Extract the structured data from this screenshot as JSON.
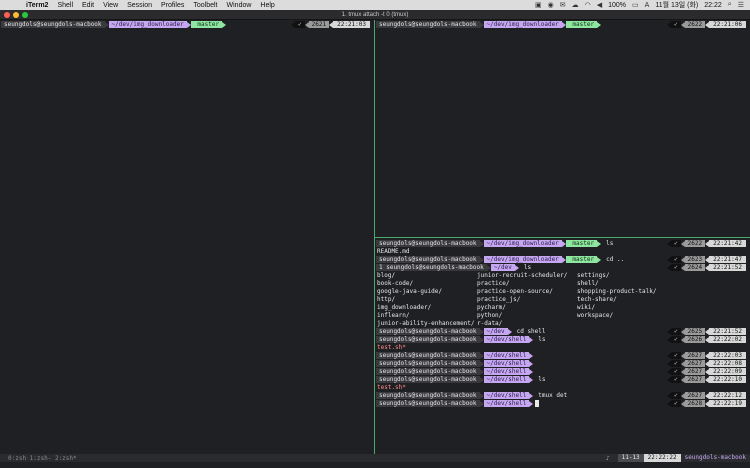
{
  "menubar": {
    "apple": "",
    "items": [
      "iTerm2",
      "Shell",
      "Edit",
      "View",
      "Session",
      "Profiles",
      "Toolbelt",
      "Window",
      "Help"
    ],
    "battery": "100%",
    "date": "11월 13일 (화)",
    "clock": "22:22"
  },
  "window": {
    "title": "1. tmux attach -t 0 (tmux)"
  },
  "panes": {
    "left": {
      "prompt": {
        "user": "seungdols@seungdols-macbook",
        "dir": "~/dev/img_downloader",
        "git": " master"
      },
      "right": {
        "check": "✓",
        "num": "2621",
        "time": "22:21:03"
      }
    },
    "top_right": {
      "prompt": {
        "user": "seungdols@seungdols-macbook",
        "dir": "~/dev/img_downloader",
        "git": " master"
      },
      "right": {
        "check": "✓",
        "num": "2622",
        "time": "22:21:06"
      }
    },
    "bottom_right": {
      "lines": [
        {
          "type": "prompt",
          "user": "seungdols@seungdols-macbook",
          "dir": "~/dev/img_downloader",
          "git": " master",
          "cmd": "ls",
          "check": "✓",
          "num": "2622",
          "time": "22:21:42"
        },
        {
          "type": "out",
          "text": "README.md"
        },
        {
          "type": "prompt",
          "user": "seungdols@seungdols-macbook",
          "dir": "~/dev/img_downloader",
          "git": " master",
          "cmd": "cd ..",
          "check": "✓",
          "num": "2623",
          "time": "22:21:47"
        },
        {
          "type": "prompt2",
          "user": "1 seungdols@seungdols-macbook",
          "dir": "~/dev",
          "cmd": "ls",
          "check": "✓",
          "num": "2624",
          "time": "22:21:52"
        },
        {
          "type": "prompt",
          "user": "seungdols@seungdols-macbook",
          "dir": "~/dev",
          "cmd": "cd shell",
          "check": "✓",
          "num": "2625",
          "time": "22:21:52"
        },
        {
          "type": "prompt",
          "user": "seungdols@seungdols-macbook",
          "dir": "~/dev/shell",
          "cmd": "ls",
          "check": "✓",
          "num": "2626",
          "time": "22:22:02"
        },
        {
          "type": "out-red",
          "text": "test.sh*"
        },
        {
          "type": "prompt",
          "user": "seungdols@seungdols-macbook",
          "dir": "~/dev/shell",
          "cmd": "",
          "check": "✓",
          "num": "2627",
          "time": "22:22:03"
        },
        {
          "type": "prompt",
          "user": "seungdols@seungdols-macbook",
          "dir": "~/dev/shell",
          "cmd": "",
          "check": "✓",
          "num": "2627",
          "time": "22:22:08"
        },
        {
          "type": "prompt",
          "user": "seungdols@seungdols-macbook",
          "dir": "~/dev/shell",
          "cmd": "",
          "check": "✓",
          "num": "2627",
          "time": "22:22:09"
        },
        {
          "type": "prompt",
          "user": "seungdols@seungdols-macbook",
          "dir": "~/dev/shell",
          "cmd": "ls",
          "check": "✓",
          "num": "2627",
          "time": "22:22:10"
        },
        {
          "type": "out-red",
          "text": "test.sh*"
        },
        {
          "type": "prompt",
          "user": "seungdols@seungdols-macbook",
          "dir": "~/dev/shell",
          "cmd": "tmux det",
          "check": "✓",
          "num": "2627",
          "time": "22:22:12"
        },
        {
          "type": "prompt",
          "user": "seungdols@seungdols-macbook",
          "dir": "~/dev/shell",
          "cmd": "",
          "check": "✓",
          "num": "2628",
          "time": "22:22:19"
        }
      ],
      "ls_columns": [
        [
          "blog/",
          "book-code/",
          "google-java-guide/",
          "http/",
          "img_downloader/",
          "inflearn/",
          "junior-ability-enhancement/"
        ],
        [
          "junior-recruit-scheduler/",
          "practice/",
          "practice-open-source/",
          "practice_js/",
          "pycharm/",
          "python/",
          "r-data/"
        ],
        [
          "settings/",
          "shell/",
          "shopping-product-talk/",
          "tech-share/",
          "wiki/",
          "workspace/"
        ]
      ]
    }
  },
  "statusbar": {
    "windows": "0:zsh  1:zsh- 2:zsh*",
    "music": "♪",
    "date": "11-13",
    "time": "22:22:22",
    "host": "seungdols-macbook"
  }
}
